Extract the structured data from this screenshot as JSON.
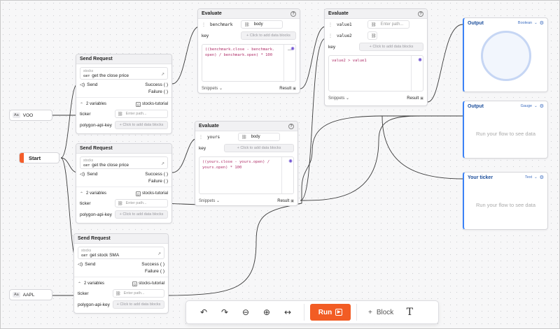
{
  "start": {
    "label": "Start"
  },
  "inputs": [
    {
      "type": "Aa",
      "value": "VOO"
    },
    {
      "type": "Aa",
      "value": "AAPL"
    }
  ],
  "send_nodes": [
    {
      "title": "Send Request",
      "call_sub": "stocks",
      "method": "GET",
      "call_name": "get the close price",
      "send_label": "Send",
      "success_label": "Success",
      "failure_label": "Failure",
      "vars_label": "2 variables",
      "env_label": "stocks-tutorial",
      "fields": [
        {
          "label": "ticker",
          "placeholder": "Enter path..."
        },
        {
          "label": "polygon-api-key",
          "placeholder": "+ Click to add data blocks"
        }
      ]
    },
    {
      "title": "Send Request",
      "call_sub": "stocks",
      "method": "GET",
      "call_name": "get the close price",
      "send_label": "Send",
      "success_label": "Success",
      "failure_label": "Failure",
      "vars_label": "2 variables",
      "env_label": "stocks-tutorial",
      "fields": [
        {
          "label": "ticker",
          "placeholder": "Enter path..."
        },
        {
          "label": "polygon-api-key",
          "placeholder": "+ Click to add data blocks"
        }
      ]
    },
    {
      "title": "Send Request",
      "call_sub": "stocks",
      "method": "GET",
      "call_name": "get stock SMA",
      "send_label": "Send",
      "success_label": "Success",
      "failure_label": "Failure",
      "vars_label": "2 variables",
      "env_label": "stocks-tutorial",
      "fields": [
        {
          "label": "ticker",
          "placeholder": "Enter path..."
        },
        {
          "label": "polygon-api-key",
          "placeholder": "+ Click to add data blocks"
        }
      ]
    }
  ],
  "eval_nodes": [
    {
      "title": "Evaluate",
      "var_name": "benchmark",
      "var_value": "body",
      "key_label": "key",
      "key_placeholder": "+ Click to add data blocks",
      "code_line1": "((benchmark.close - benchmark.",
      "code_line2": "open) / benchmark.open) * 100",
      "snippets_label": "Snippets",
      "result_label": "Result"
    },
    {
      "title": "Evaluate",
      "var_name": "yours",
      "var_value": "body",
      "key_label": "key",
      "key_placeholder": "+ Click to add data blocks",
      "code_line1": "((yours.close - yours.open) /",
      "code_line2": "yours.open) * 100",
      "snippets_label": "Snippets",
      "result_label": "Result"
    },
    {
      "title": "Evaluate",
      "var1_name": "value1",
      "var1_placeholder": "Enter path...",
      "var2_name": "value2",
      "key_label": "key",
      "key_placeholder": "+ Click to add data blocks",
      "code_line1": "value2 > value1",
      "snippets_label": "Snippets",
      "result_label": "Result"
    }
  ],
  "outputs": [
    {
      "title": "Output",
      "type": "Boolean"
    },
    {
      "title": "Output",
      "type": "Gauge",
      "placeholder": "Run your flow to see data"
    },
    {
      "title": "Your ticker",
      "type": "Text",
      "placeholder": "Run your flow to see data"
    }
  ],
  "toolbar": {
    "run_label": "Run",
    "block_label": "Block"
  },
  "colors": {
    "accent": "#f25c24",
    "output_blue": "#3b82f6",
    "code": "#b0306a"
  }
}
